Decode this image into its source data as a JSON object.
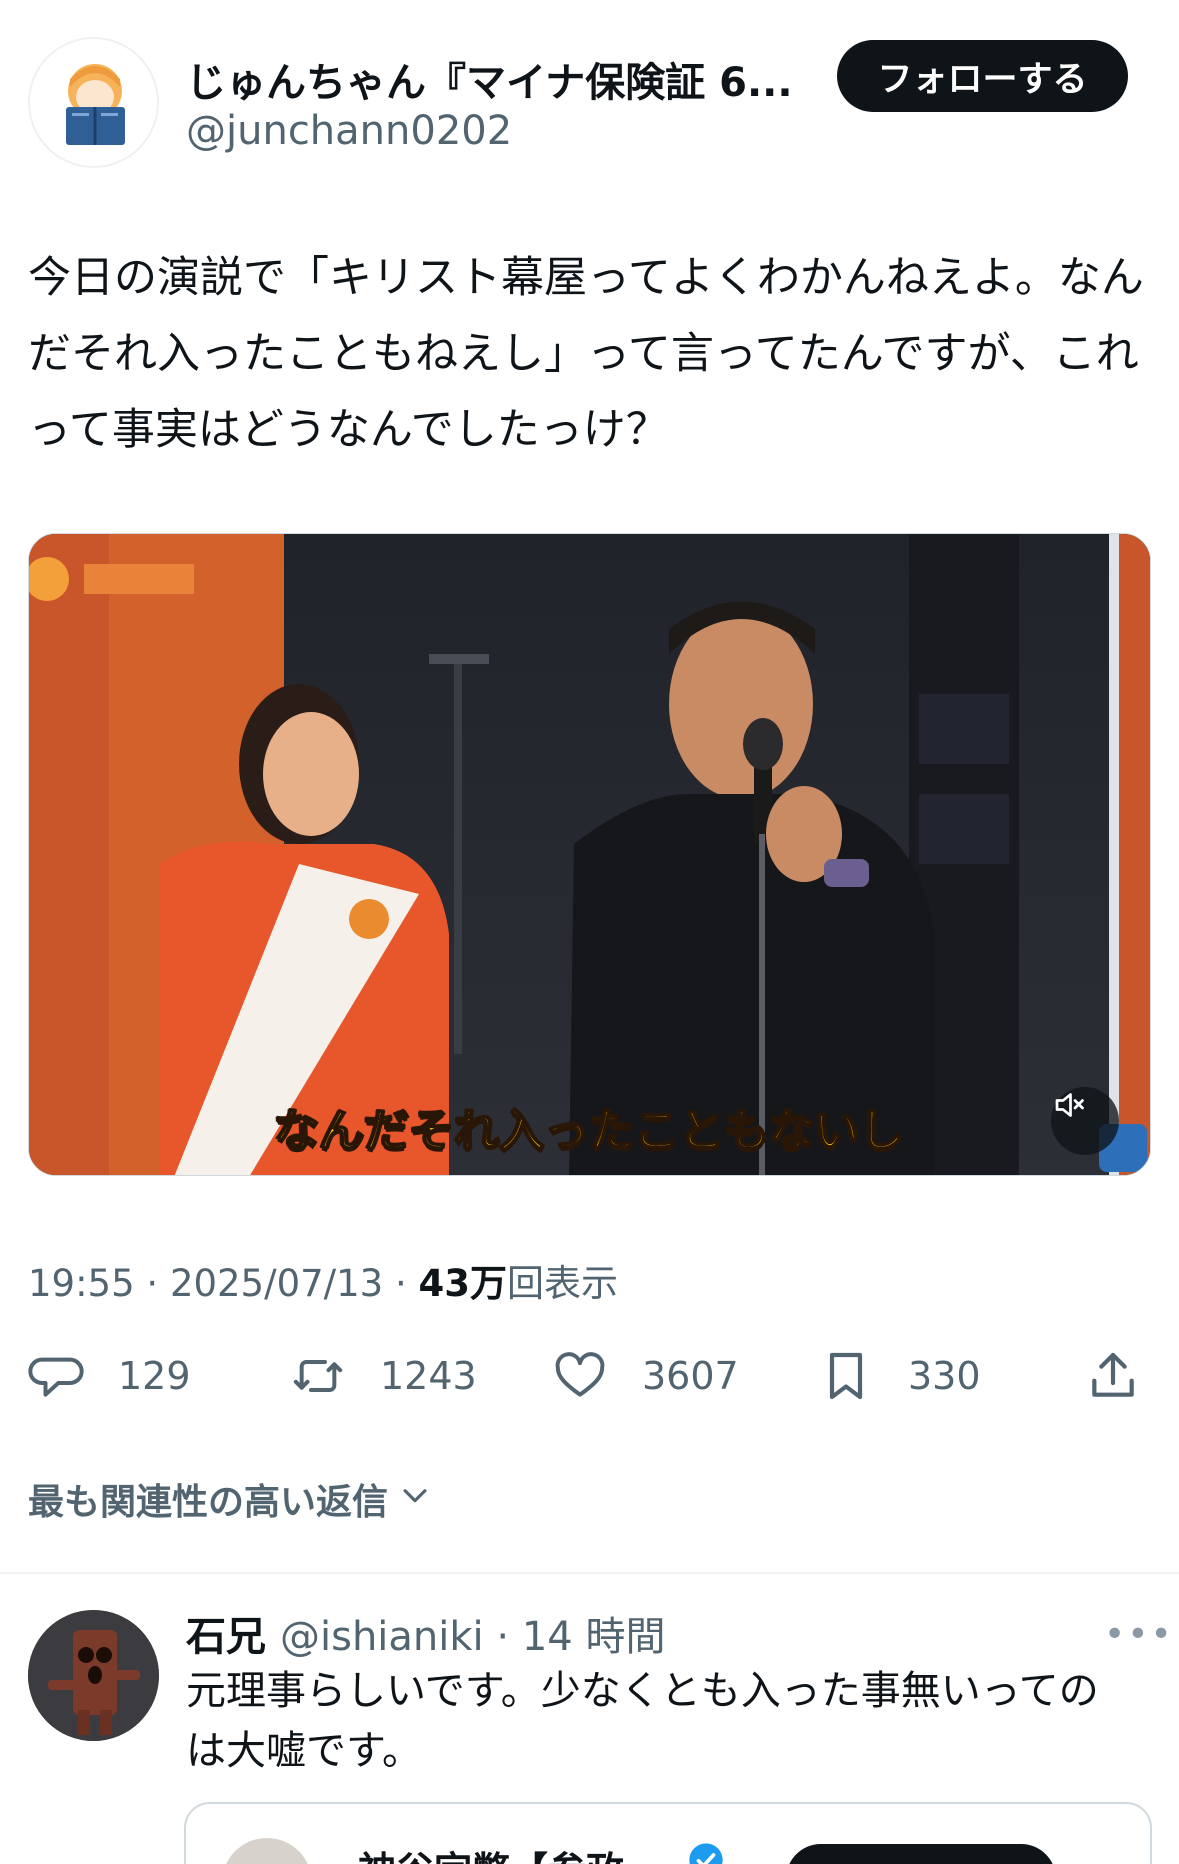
{
  "header": {
    "display_name": "じゅんちゃん『マイナ保険証 6...",
    "handle": "@junchann0202",
    "follow_label": "フォローする"
  },
  "tweet": {
    "text": "今日の演説で「キリスト幕屋ってよくわかんねえよ。なんだそれ入ったこともねえし」って言ってたんですが、これって事実はどうなんでしたっけ？",
    "video_subtitle": "なんだそれ入ったこともないし",
    "time": "19:55",
    "date": "2025/07/13",
    "views_number": "43万",
    "views_label": "回表示"
  },
  "actions": {
    "replies": "129",
    "reposts": "1243",
    "likes": "3607",
    "bookmarks": "330"
  },
  "relevance_label": "最も関連性の高い返信",
  "reply": {
    "name": "石兄",
    "handle": "@ishianiki",
    "time": "14 時間",
    "text": "元理事らしいです。少なくとも入った事無いってのは大嘘です。",
    "quote_name": "神谷宗幣【参政"
  },
  "colors": {
    "text": "#0f1419",
    "secondary": "#536471",
    "button": "#0f1419",
    "verified": "#1d9bf0"
  }
}
